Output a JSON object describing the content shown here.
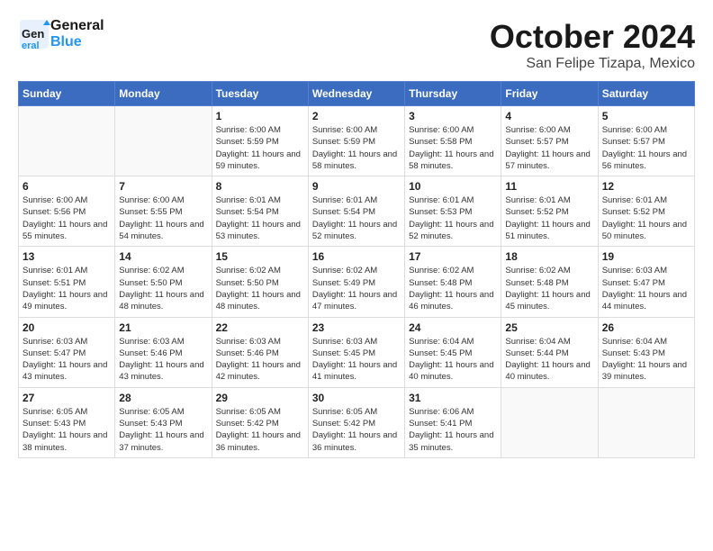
{
  "logo": {
    "line1": "General",
    "line2": "Blue"
  },
  "title": "October 2024",
  "location": "San Felipe Tizapa, Mexico",
  "weekdays": [
    "Sunday",
    "Monday",
    "Tuesday",
    "Wednesday",
    "Thursday",
    "Friday",
    "Saturday"
  ],
  "weeks": [
    [
      {
        "day": "",
        "info": ""
      },
      {
        "day": "",
        "info": ""
      },
      {
        "day": "1",
        "info": "Sunrise: 6:00 AM\nSunset: 5:59 PM\nDaylight: 11 hours and 59 minutes."
      },
      {
        "day": "2",
        "info": "Sunrise: 6:00 AM\nSunset: 5:59 PM\nDaylight: 11 hours and 58 minutes."
      },
      {
        "day": "3",
        "info": "Sunrise: 6:00 AM\nSunset: 5:58 PM\nDaylight: 11 hours and 58 minutes."
      },
      {
        "day": "4",
        "info": "Sunrise: 6:00 AM\nSunset: 5:57 PM\nDaylight: 11 hours and 57 minutes."
      },
      {
        "day": "5",
        "info": "Sunrise: 6:00 AM\nSunset: 5:57 PM\nDaylight: 11 hours and 56 minutes."
      }
    ],
    [
      {
        "day": "6",
        "info": "Sunrise: 6:00 AM\nSunset: 5:56 PM\nDaylight: 11 hours and 55 minutes."
      },
      {
        "day": "7",
        "info": "Sunrise: 6:00 AM\nSunset: 5:55 PM\nDaylight: 11 hours and 54 minutes."
      },
      {
        "day": "8",
        "info": "Sunrise: 6:01 AM\nSunset: 5:54 PM\nDaylight: 11 hours and 53 minutes."
      },
      {
        "day": "9",
        "info": "Sunrise: 6:01 AM\nSunset: 5:54 PM\nDaylight: 11 hours and 52 minutes."
      },
      {
        "day": "10",
        "info": "Sunrise: 6:01 AM\nSunset: 5:53 PM\nDaylight: 11 hours and 52 minutes."
      },
      {
        "day": "11",
        "info": "Sunrise: 6:01 AM\nSunset: 5:52 PM\nDaylight: 11 hours and 51 minutes."
      },
      {
        "day": "12",
        "info": "Sunrise: 6:01 AM\nSunset: 5:52 PM\nDaylight: 11 hours and 50 minutes."
      }
    ],
    [
      {
        "day": "13",
        "info": "Sunrise: 6:01 AM\nSunset: 5:51 PM\nDaylight: 11 hours and 49 minutes."
      },
      {
        "day": "14",
        "info": "Sunrise: 6:02 AM\nSunset: 5:50 PM\nDaylight: 11 hours and 48 minutes."
      },
      {
        "day": "15",
        "info": "Sunrise: 6:02 AM\nSunset: 5:50 PM\nDaylight: 11 hours and 48 minutes."
      },
      {
        "day": "16",
        "info": "Sunrise: 6:02 AM\nSunset: 5:49 PM\nDaylight: 11 hours and 47 minutes."
      },
      {
        "day": "17",
        "info": "Sunrise: 6:02 AM\nSunset: 5:48 PM\nDaylight: 11 hours and 46 minutes."
      },
      {
        "day": "18",
        "info": "Sunrise: 6:02 AM\nSunset: 5:48 PM\nDaylight: 11 hours and 45 minutes."
      },
      {
        "day": "19",
        "info": "Sunrise: 6:03 AM\nSunset: 5:47 PM\nDaylight: 11 hours and 44 minutes."
      }
    ],
    [
      {
        "day": "20",
        "info": "Sunrise: 6:03 AM\nSunset: 5:47 PM\nDaylight: 11 hours and 43 minutes."
      },
      {
        "day": "21",
        "info": "Sunrise: 6:03 AM\nSunset: 5:46 PM\nDaylight: 11 hours and 43 minutes."
      },
      {
        "day": "22",
        "info": "Sunrise: 6:03 AM\nSunset: 5:46 PM\nDaylight: 11 hours and 42 minutes."
      },
      {
        "day": "23",
        "info": "Sunrise: 6:03 AM\nSunset: 5:45 PM\nDaylight: 11 hours and 41 minutes."
      },
      {
        "day": "24",
        "info": "Sunrise: 6:04 AM\nSunset: 5:45 PM\nDaylight: 11 hours and 40 minutes."
      },
      {
        "day": "25",
        "info": "Sunrise: 6:04 AM\nSunset: 5:44 PM\nDaylight: 11 hours and 40 minutes."
      },
      {
        "day": "26",
        "info": "Sunrise: 6:04 AM\nSunset: 5:43 PM\nDaylight: 11 hours and 39 minutes."
      }
    ],
    [
      {
        "day": "27",
        "info": "Sunrise: 6:05 AM\nSunset: 5:43 PM\nDaylight: 11 hours and 38 minutes."
      },
      {
        "day": "28",
        "info": "Sunrise: 6:05 AM\nSunset: 5:43 PM\nDaylight: 11 hours and 37 minutes."
      },
      {
        "day": "29",
        "info": "Sunrise: 6:05 AM\nSunset: 5:42 PM\nDaylight: 11 hours and 36 minutes."
      },
      {
        "day": "30",
        "info": "Sunrise: 6:05 AM\nSunset: 5:42 PM\nDaylight: 11 hours and 36 minutes."
      },
      {
        "day": "31",
        "info": "Sunrise: 6:06 AM\nSunset: 5:41 PM\nDaylight: 11 hours and 35 minutes."
      },
      {
        "day": "",
        "info": ""
      },
      {
        "day": "",
        "info": ""
      }
    ]
  ]
}
